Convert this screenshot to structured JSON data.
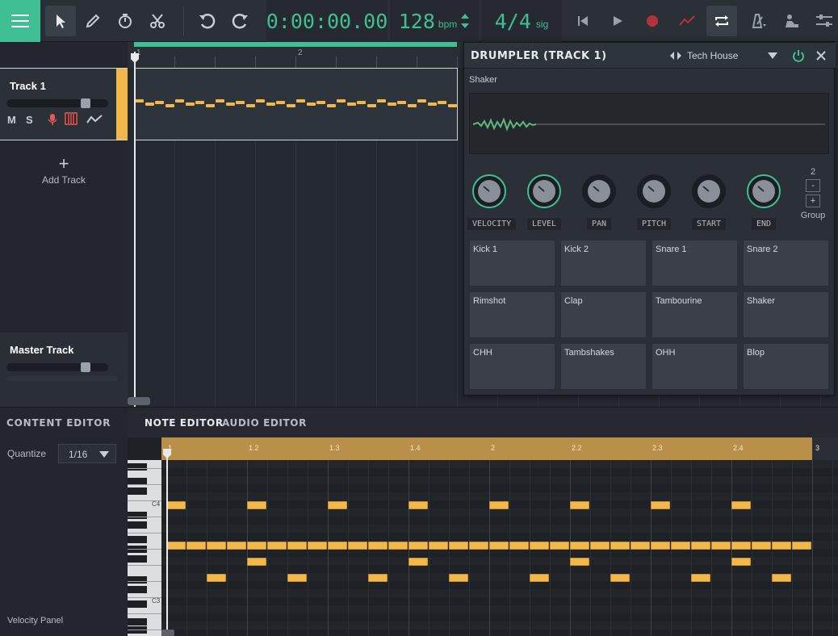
{
  "toolbar": {
    "time": "0:00:00.00",
    "bpm_value": "128",
    "bpm_unit": "bpm",
    "sig_value": "4/4",
    "sig_unit": "sig"
  },
  "tracks": {
    "track1_name": "Track 1",
    "mute_label": "M",
    "solo_label": "S",
    "add_track_label": "Add Track",
    "master_name": "Master Track",
    "track1_volume": 0.78,
    "master_volume": 0.78
  },
  "arrangement": {
    "ruler_marks": [
      "1",
      "2"
    ]
  },
  "drumpler": {
    "title": "DRUMPLER (TRACK 1)",
    "preset": "Tech House",
    "instrument": "Shaker",
    "knobs": [
      "VELOCITY",
      "LEVEL",
      "PAN",
      "PITCH",
      "START",
      "END"
    ],
    "group_value": "2",
    "group_minus": "-",
    "group_plus": "+",
    "group_label": "Group",
    "pads": [
      "Kick 1",
      "Kick 2",
      "Snare 1",
      "Snare 2",
      "Rimshot",
      "Clap",
      "Tambourine",
      "Shaker",
      "CHH",
      "Tambshakes",
      "OHH",
      "Blop"
    ]
  },
  "content_editor": {
    "title": "CONTENT EDITOR",
    "quantize_label": "Quantize",
    "quantize_value": "1/16",
    "velocity_panel": "Velocity Panel"
  },
  "editor_tabs": {
    "note": "NOTE EDITOR",
    "audio": "AUDIO EDITOR"
  },
  "note_editor": {
    "ruler": [
      "1",
      "1.2",
      "1.3",
      "1.4",
      "2",
      "2.2",
      "2.3",
      "2.4",
      "3"
    ],
    "octave_labels": [
      "C4",
      "C3"
    ]
  },
  "colors": {
    "accent": "#3fbf93",
    "note": "#f2b84b",
    "record": "#c0392b"
  }
}
